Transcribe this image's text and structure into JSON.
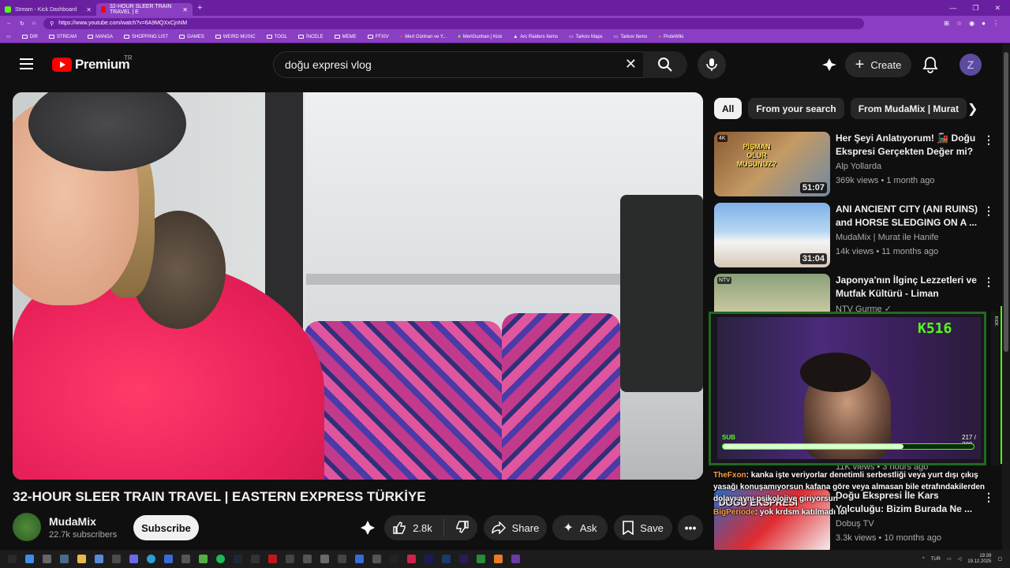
{
  "browser": {
    "tabs": [
      {
        "title": "Stream - Kick Dashboard",
        "active": false
      },
      {
        "title": "32-HOUR SLEER TRAIN TRAVEL | E",
        "active": true
      }
    ],
    "url": "https://www.youtube.com/watch?v=6A9MQXxCjnNM",
    "bookmarks": [
      "DIR",
      "STREAM",
      "MANGA",
      "SHOPPING LIST",
      "GAMES",
      "WEIRD MUSIC",
      "TOOL",
      "İNCELE",
      "MEME",
      "FFXIV",
      "Mert Günhan ve Y...",
      "MertGunhan | Kick",
      "Arc Raiders Items",
      "Tarkov Maps",
      "Tarkov Items",
      "ProleWiki"
    ]
  },
  "header": {
    "brand": "Premium",
    "region": "TR",
    "search_query": "doğu expresi vlog",
    "create_label": "Create",
    "avatar_letter": "Z"
  },
  "video": {
    "title": "32-HOUR SLEER TRAIN TRAVEL | EASTERN EXPRESS TÜRKİYE",
    "channel": "MudaMix",
    "subscribers": "22.7k subscribers",
    "subscribe_label": "Subscribe",
    "likes": "2.8k",
    "share_label": "Share",
    "ask_label": "Ask",
    "save_label": "Save"
  },
  "chips": [
    "All",
    "From your search",
    "From MudaMix | Murat"
  ],
  "recommendations": [
    {
      "title": "Her Şeyi Anlatıyorum! 🚂 Doğu Ekspresi Gerçekten Değer mi? ...",
      "channel": "Alp Yollarda",
      "meta": "369k views • 1 month ago",
      "duration": "51:07",
      "badge": "4K",
      "thumb_text": "PİŞMAN OLUR MUSUNUZ?"
    },
    {
      "title": "ANI ANCIENT CITY (ANI RUINS) and HORSE SLEDGING ON A ...",
      "channel": "MudaMix | Murat ile Hanife",
      "meta": "14k views • 11 months ago",
      "duration": "31:04",
      "badge": "",
      "thumb_text": ""
    },
    {
      "title": "Japonya'nın İlginç Lezzetleri ve Mutfak Kültürü - Liman Günlüğ...",
      "channel": "NTV Gurme ✓",
      "meta": "",
      "duration": "",
      "badge": "NTV",
      "thumb_text": ""
    },
    {
      "title": "Doğu Ekspresi İle Kars Yolculuğu: Bizim Burada Ne ...",
      "channel": "Dobuş TV",
      "meta": "3.3k views • 10 months ago",
      "duration": "",
      "badge": "",
      "thumb_text": "DOĞU EKSPRESİ"
    }
  ],
  "partial_meta": "11K views • 3 hours ago",
  "overlay": {
    "k_count": "516",
    "sub_label": "SUB",
    "sub_count": "217 / 300",
    "sub_progress": 0.72,
    "side_label": "KICK"
  },
  "chat": [
    {
      "user": "TheFxon",
      "text": ": kanka işte veriyorlar denetimli serbestliği veya yurt dışı çıkış"
    },
    {
      "user": "",
      "text": "yasağı konuşamıyorsun kafana göre veya almasan bile etrafındakilerden"
    },
    {
      "user": "",
      "text": "dolayı aynı psikolojiye giriyorsun"
    },
    {
      "user": "BigPeriode",
      "text": ": yok krdsm katılmadı lol"
    }
  ],
  "taskbar": {
    "lang": "TUR",
    "time": "19:39",
    "date": "19.12.2025"
  },
  "colors": {
    "browser": "#8a3fc2",
    "yt_red": "#ff0000",
    "kick_green": "#53fc18"
  }
}
